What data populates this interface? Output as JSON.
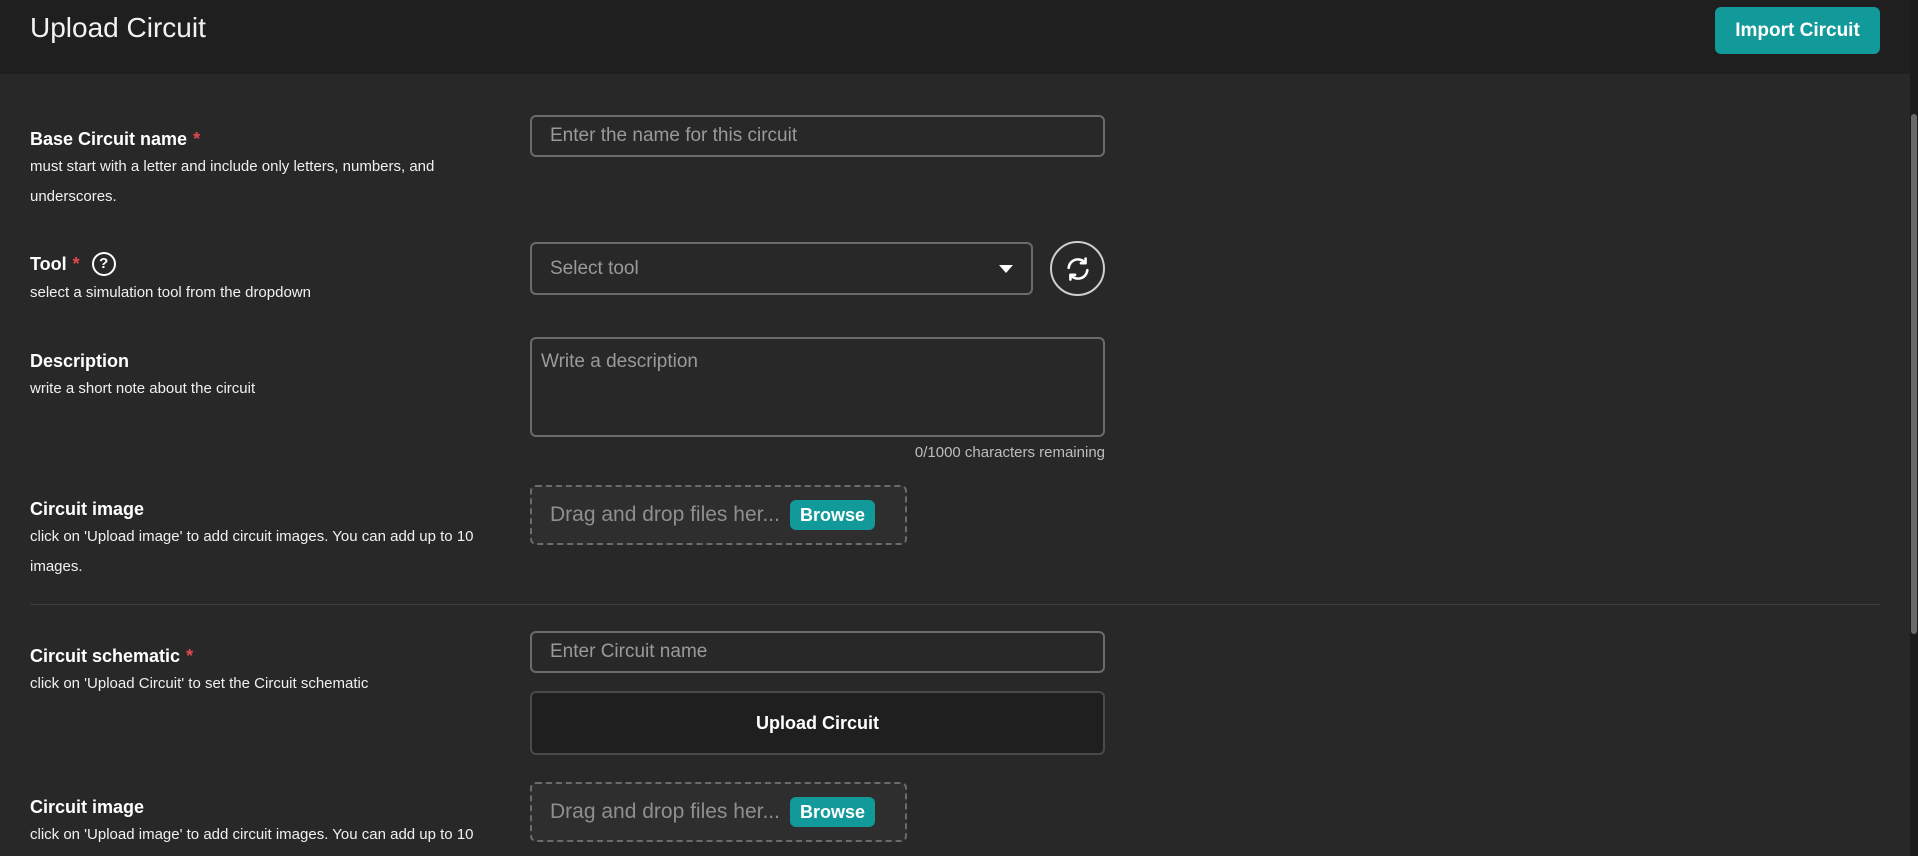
{
  "header": {
    "title": "Upload Circuit",
    "import_button": "Import Circuit"
  },
  "form": {
    "base_name": {
      "title": "Base Circuit name",
      "required": "*",
      "help": "must start with a letter and include only letters, numbers, and underscores.",
      "placeholder": "Enter the name for this circuit",
      "value": ""
    },
    "tool": {
      "title": "Tool",
      "required": "*",
      "help_icon": "?",
      "help": "select a simulation tool from the dropdown",
      "selected": "Select tool"
    },
    "description": {
      "title": "Description",
      "help": "write a short note about the circuit",
      "placeholder": "Write a description",
      "value": "",
      "char_count": "0/1000 characters remaining"
    },
    "circuit_image_1": {
      "title": "Circuit image",
      "help": "click on 'Upload image' to add circuit images. You can add up to 10 images.",
      "dropzone_text": "Drag and drop files her...",
      "browse": "Browse"
    },
    "schematic": {
      "title": "Circuit schematic",
      "required": "*",
      "help": "click on 'Upload Circuit' to set the Circuit schematic",
      "placeholder": "Enter Circuit name",
      "value": "",
      "upload_button": "Upload Circuit"
    },
    "circuit_image_2": {
      "title": "Circuit image",
      "help": "click on 'Upload image' to add circuit images. You can add up to 10",
      "dropzone_text": "Drag and drop files her...",
      "browse": "Browse"
    }
  },
  "colors": {
    "accent": "#12999a",
    "required": "#e5484d",
    "background": "#282828",
    "header": "#1f1f1f"
  },
  "icons": {
    "refresh": "refresh-icon",
    "help": "question-circle-icon",
    "caret": "caret-down-icon"
  }
}
